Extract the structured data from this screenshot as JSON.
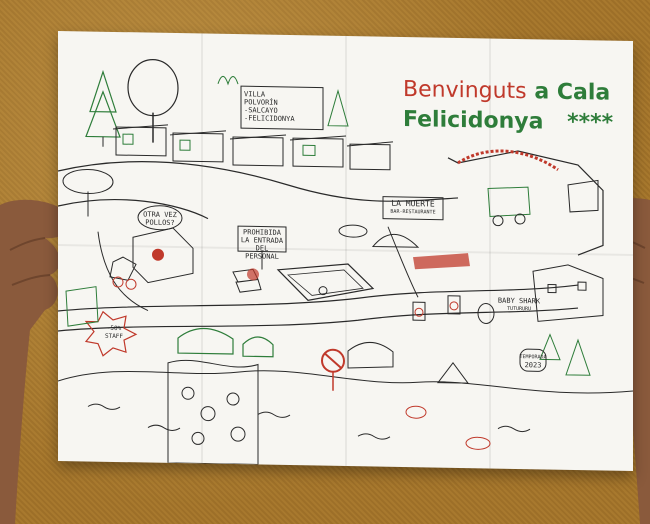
{
  "title": {
    "line1_red": "Benvinguts",
    "line1_green": "a Cala",
    "line2_green": "Felicidonya",
    "stars": "****"
  },
  "labels": {
    "villa_line1": "VILLA",
    "villa_line2": "POLVORÍN",
    "villa_line3": "-SALCAYO",
    "villa_line4": "-FELICIDONYA",
    "bubble_line1": "OTRA VEZ",
    "bubble_line2": "POLLOS?",
    "sign_line1": "PROHIBIDA",
    "sign_line2": "LA ENTRADA",
    "sign_line3": "DEL PERSONAL",
    "muerte_line1": "LA MUERTE",
    "muerte_line2": "BAR-RESTAURANTE",
    "baby_line1": "BABY SHARK",
    "baby_line2": "TUTURURU",
    "tomb_line1": "TEMPORADA",
    "tomb_line2": "2023",
    "burst_line1": "-50%",
    "burst_line2": "STAFF"
  },
  "colors": {
    "ink": "#2a2a2a",
    "green": "#2e7d3a",
    "red": "#c0392b",
    "paper": "#f7f6f2",
    "table": "#a8792e"
  }
}
